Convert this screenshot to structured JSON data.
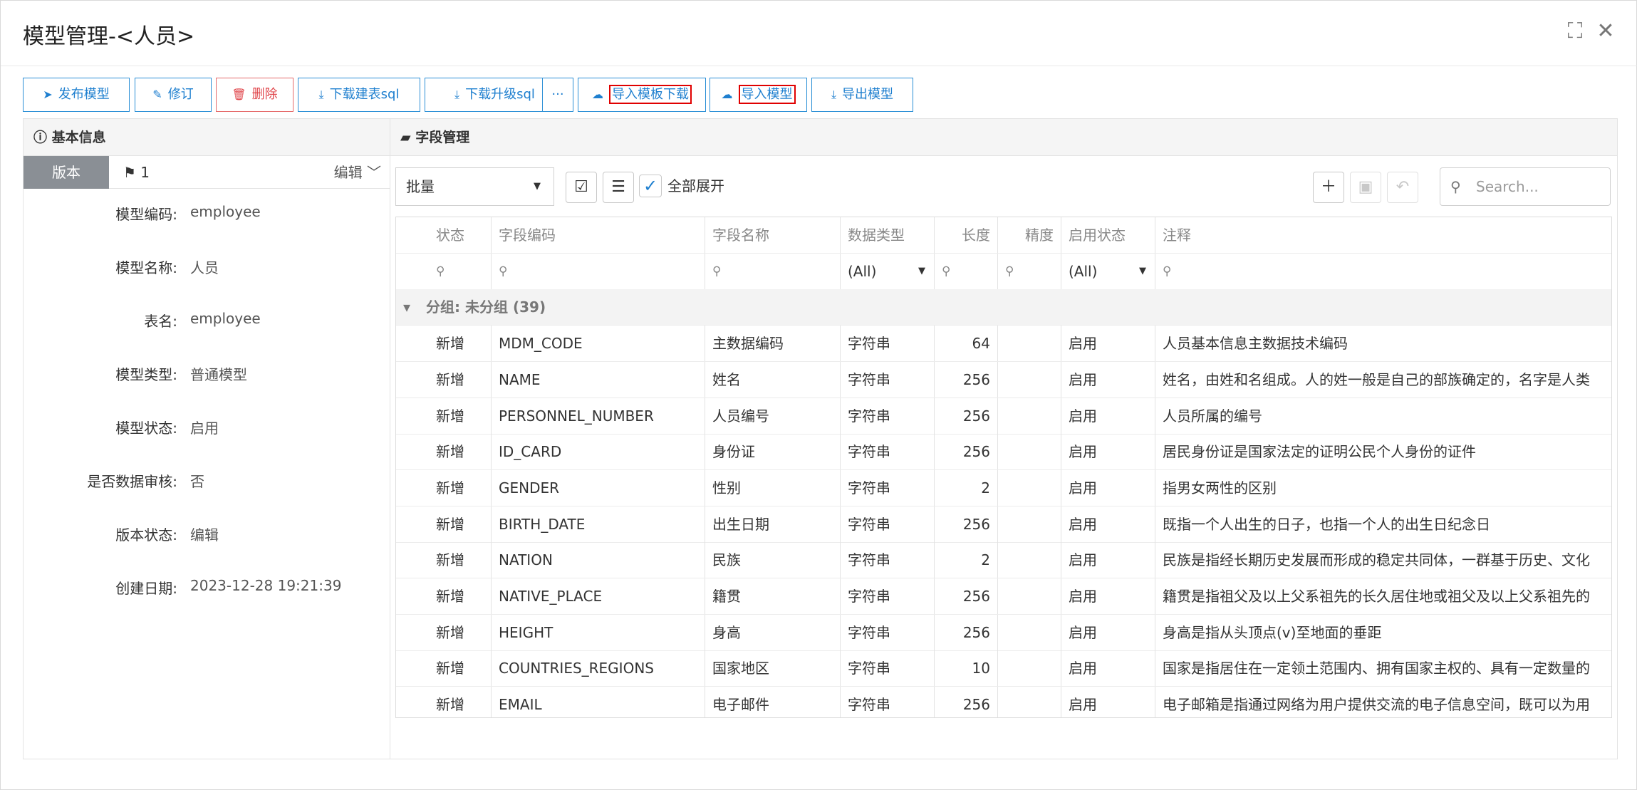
{
  "window": {
    "title": "模型管理-<人员>"
  },
  "toolbar": {
    "publish": "发布模型",
    "revise": "修订",
    "delete": "删除",
    "download_create_sql": "下载建表sql",
    "download_upgrade_sql": "下载升级sql",
    "more": "···",
    "import_template_download": "导入模板下载",
    "import_model": "导入模型",
    "export_model": "导出模型"
  },
  "left": {
    "header": "基本信息",
    "version_tab": "版本",
    "version_number": "1",
    "edit_label": "编辑",
    "fields": [
      {
        "label": "模型编码:",
        "value": "employee"
      },
      {
        "label": "模型名称:",
        "value": "人员"
      },
      {
        "label": "表名:",
        "value": "employee"
      },
      {
        "label": "模型类型:",
        "value": "普通模型"
      },
      {
        "label": "模型状态:",
        "value": "启用"
      },
      {
        "label": "是否数据审核:",
        "value": "否"
      },
      {
        "label": "版本状态:",
        "value": "编辑"
      },
      {
        "label": "创建日期:",
        "value": "2023-12-28 19:21:39"
      }
    ]
  },
  "right": {
    "header": "字段管理",
    "batch_select": "批量",
    "expand_all": "全部展开",
    "search_placeholder": "Search...",
    "columns": [
      "状态",
      "字段编码",
      "字段名称",
      "数据类型",
      "长度",
      "精度",
      "启用状态",
      "注释"
    ],
    "filter_all": "(All)",
    "group_label": "分组: 未分组 (39)",
    "rows": [
      [
        "新增",
        "MDM_CODE",
        "主数据编码",
        "字符串",
        "64",
        "",
        "启用",
        "人员基本信息主数据技术编码"
      ],
      [
        "新增",
        "NAME",
        "姓名",
        "字符串",
        "256",
        "",
        "启用",
        "姓名，由姓和名组成。人的姓一般是自己的部族确定的，名字是人类"
      ],
      [
        "新增",
        "PERSONNEL_NUMBER",
        "人员编号",
        "字符串",
        "256",
        "",
        "启用",
        "人员所属的编号"
      ],
      [
        "新增",
        "ID_CARD",
        "身份证",
        "字符串",
        "256",
        "",
        "启用",
        "居民身份证是国家法定的证明公民个人身份的证件"
      ],
      [
        "新增",
        "GENDER",
        "性别",
        "字符串",
        "2",
        "",
        "启用",
        "指男女两性的区别"
      ],
      [
        "新增",
        "BIRTH_DATE",
        "出生日期",
        "字符串",
        "256",
        "",
        "启用",
        "既指一个人出生的日子，也指一个人的出生日纪念日"
      ],
      [
        "新增",
        "NATION",
        "民族",
        "字符串",
        "2",
        "",
        "启用",
        "民族是指经长期历史发展而形成的稳定共同体，一群基于历史、文化"
      ],
      [
        "新增",
        "NATIVE_PLACE",
        "籍贯",
        "字符串",
        "256",
        "",
        "启用",
        "籍贯是指祖父及以上父系祖先的长久居住地或祖父及以上父系祖先的"
      ],
      [
        "新增",
        "HEIGHT",
        "身高",
        "字符串",
        "256",
        "",
        "启用",
        "身高是指从头顶点(v)至地面的垂距"
      ],
      [
        "新增",
        "COUNTRIES_REGIONS",
        "国家地区",
        "字符串",
        "10",
        "",
        "启用",
        "国家是指居住在一定领土范围内、拥有国家主权的、具有一定数量的"
      ],
      [
        "新增",
        "EMAIL",
        "电子邮件",
        "字符串",
        "256",
        "",
        "启用",
        "电子邮箱是指通过网络为用户提供交流的电子信息空间，既可以为用"
      ]
    ]
  }
}
